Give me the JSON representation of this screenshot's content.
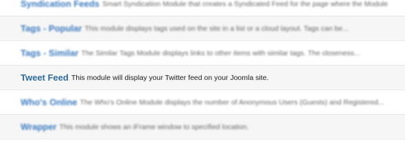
{
  "modules": [
    {
      "title": "Syndication Feeds",
      "description": "Smart Syndication Module that creates a Syndicated Feed for the page where the Module"
    },
    {
      "title": "Tags - Popular",
      "description": "This module displays tags used on the site in a list or a cloud layout. Tags can be..."
    },
    {
      "title": "Tags - Similar",
      "description": "The Similar Tags Module displays links to other items with similar tags. The closeness..."
    },
    {
      "title": "Tweet Feed",
      "description": "This module will display your Twitter feed on your Joomla site."
    },
    {
      "title": "Who's Online",
      "description": "The Who's Online Module displays the number of Anonymous Users (Guests) and Registered..."
    },
    {
      "title": "Wrapper",
      "description": "This module shows an iFrame window to specified location."
    }
  ]
}
